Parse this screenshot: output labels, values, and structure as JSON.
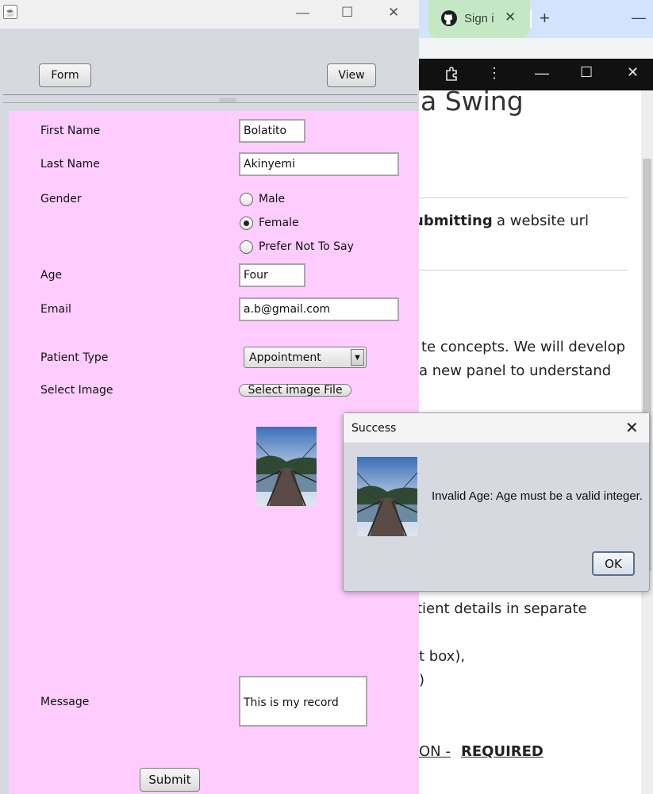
{
  "browser": {
    "tab_title": "Sign i",
    "tab_close": "✕",
    "new_tab": "+",
    "minimize": "—",
    "url_hint": "",
    "dark_bar": {
      "extension": "",
      "menu": "⋮",
      "minimize": "—",
      "maximize": "☐",
      "close": "✕"
    }
  },
  "article": {
    "heading": "a Swing",
    "lines": [
      "ubmitting",
      "a website url",
      "te concepts. We will develop",
      "a new panel to understand",
      "tient details in separate",
      "t box),",
      ")",
      "ON -",
      "REQUIRED"
    ]
  },
  "swing_window": {
    "controls": {
      "minimize": "—",
      "maximize": "☐",
      "close": "✕"
    },
    "buttons": {
      "form": "Form",
      "view": "View",
      "submit": "Submit",
      "select_image": "Select image File"
    },
    "labels": {
      "first_name": "First Name",
      "last_name": "Last Name",
      "gender": "Gender",
      "age": "Age",
      "email": "Email",
      "patient_type": "Patient Type",
      "select_image": "Select Image",
      "message": "Message"
    },
    "fields": {
      "first_name": "Bolatito",
      "last_name": "Akinyemi",
      "age": "Four",
      "email": "a.b@gmail.com",
      "message": "This is my record"
    },
    "gender_options": [
      {
        "label": "Male",
        "selected": false
      },
      {
        "label": "Female",
        "selected": true
      },
      {
        "label": "Prefer Not To Say",
        "selected": false
      }
    ],
    "patient_type": {
      "selected": "Appointment",
      "arrow": "▼"
    },
    "colors": {
      "form_background": "#ffccff",
      "window_background": "#d6d9df"
    }
  },
  "dialog": {
    "title": "Success",
    "close": "✕",
    "message": "Invalid Age: Age must be a valid integer.",
    "ok_label": "OK"
  }
}
